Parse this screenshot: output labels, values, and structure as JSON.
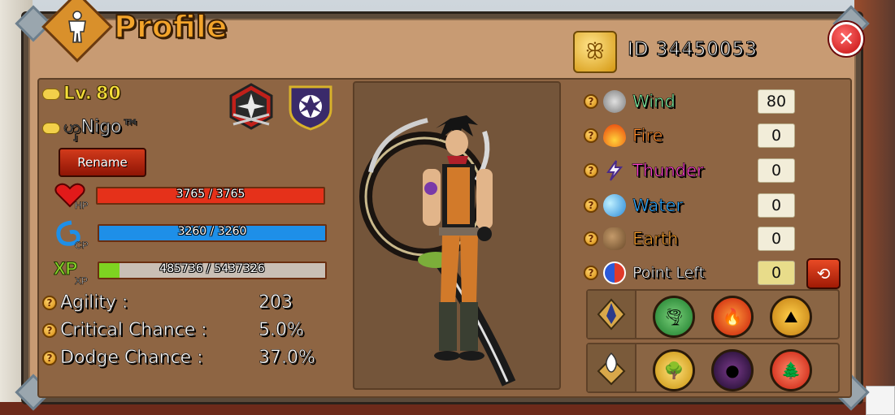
{
  "window": {
    "title": "Profile",
    "close_label": "✕"
  },
  "player": {
    "id_label": "ID",
    "id": "34450053",
    "level_label": "Lv.",
    "level": "80",
    "name": "ၯNigo™",
    "rename_label": "Rename"
  },
  "stats": {
    "hp": {
      "label": "HP",
      "text": "3765 / 3765",
      "fill": 1.0,
      "color": "#e5311a"
    },
    "cp": {
      "label": "CP",
      "text": "3260 / 3260",
      "fill": 1.0,
      "color": "#1e8fe8"
    },
    "xp": {
      "label": "XP",
      "text": "485736 / 5437326",
      "fill": 0.089,
      "color": "#7ed321"
    }
  },
  "details": [
    {
      "label": "Agility :",
      "value": "203"
    },
    {
      "label": "Critical Chance :",
      "value": "5.0%"
    },
    {
      "label": "Dodge Chance :",
      "value": "37.0%"
    }
  ],
  "elements": [
    {
      "name": "Wind",
      "value": "80",
      "color": "#7ef0a3",
      "icon": "wind-tornado-icon"
    },
    {
      "name": "Fire",
      "value": "0",
      "color": "#ff8a2a",
      "icon": "fire-icon"
    },
    {
      "name": "Thunder",
      "value": "0",
      "color": "#ff3fd0",
      "icon": "thunder-icon"
    },
    {
      "name": "Water",
      "value": "0",
      "color": "#2ea8ff",
      "icon": "water-wave-icon"
    },
    {
      "name": "Earth",
      "value": "0",
      "color": "#f29a2a",
      "icon": "earth-rock-icon"
    },
    {
      "name": "Point Left",
      "value": "0",
      "color": "#ffffff",
      "icon": "yin-yang-icon"
    }
  ],
  "help_symbol": "?"
}
